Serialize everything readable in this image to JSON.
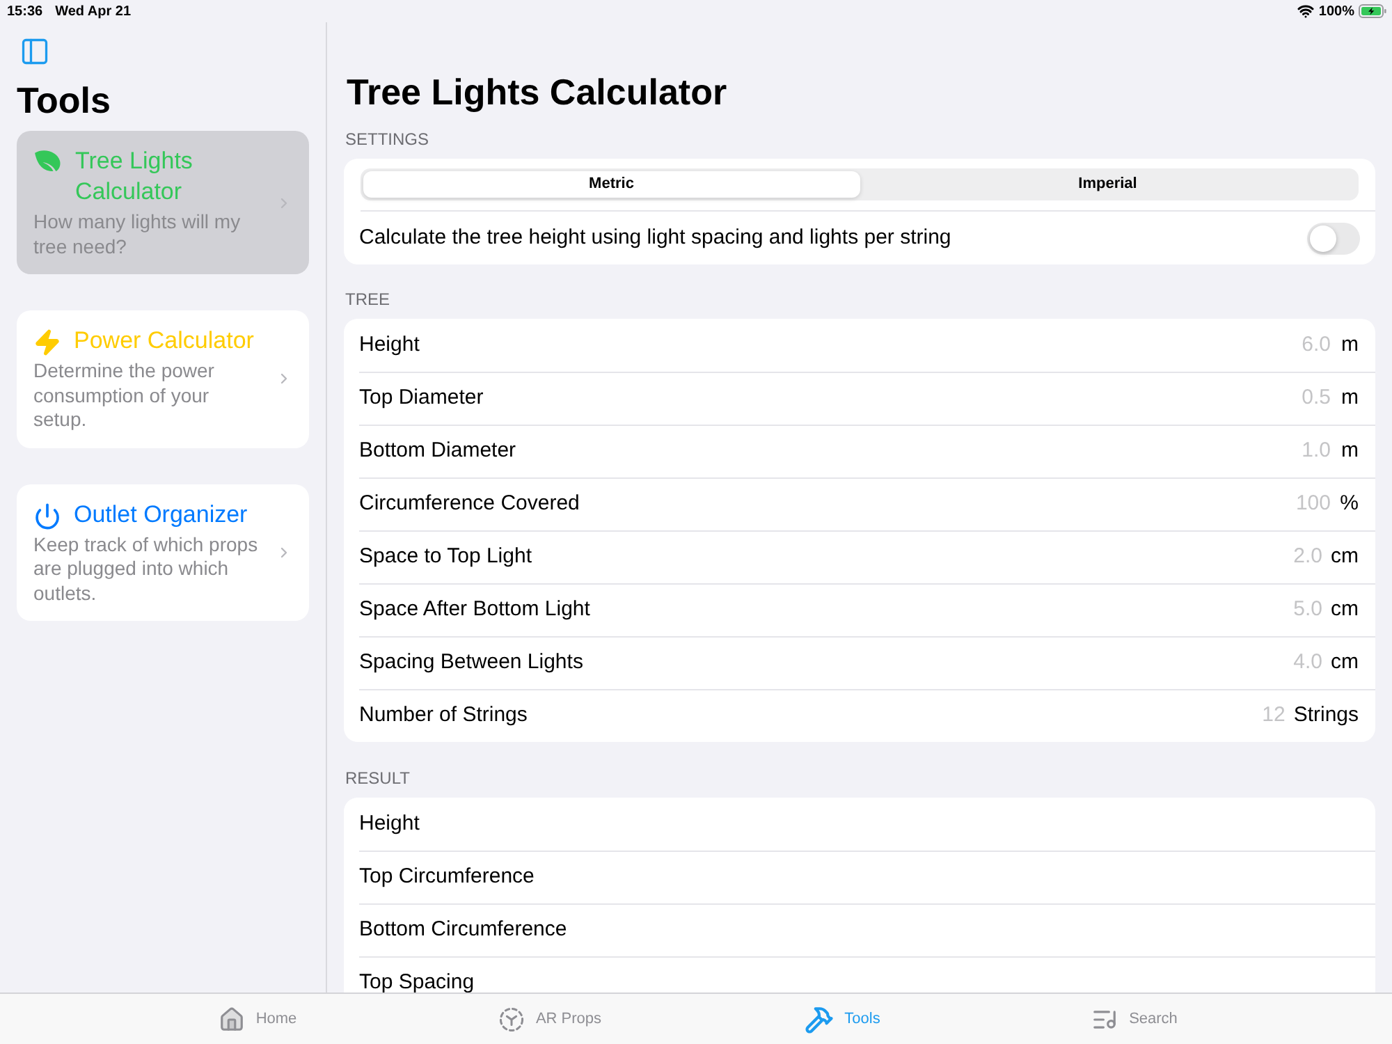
{
  "status_bar": {
    "time": "15:36",
    "date": "Wed Apr 21",
    "battery": "100%"
  },
  "sidebar": {
    "title": "Tools",
    "items": [
      {
        "title": "Tree Lights Calculator",
        "description": "How many lights will my tree need?",
        "color": "#34c759",
        "selected": true
      },
      {
        "title": "Power Calculator",
        "description": "Determine the power consumption of your setup.",
        "color": "#ffcc00",
        "selected": false
      },
      {
        "title": "Outlet Organizer",
        "description": "Keep track of which props are plugged into which outlets.",
        "color": "#007aff",
        "selected": false
      }
    ]
  },
  "main": {
    "title": "Tree Lights Calculator"
  },
  "settings": {
    "header": "SETTINGS",
    "units": [
      {
        "label": "Metric",
        "selected": true
      },
      {
        "label": "Imperial",
        "selected": false
      }
    ],
    "toggle": {
      "label": "Calculate the tree height using light spacing and lights per string",
      "on": false
    }
  },
  "tree": {
    "header": "TREE",
    "fields": [
      {
        "label": "Height",
        "placeholder": "6.0",
        "unit": "m"
      },
      {
        "label": "Top Diameter",
        "placeholder": "0.5",
        "unit": "m"
      },
      {
        "label": "Bottom Diameter",
        "placeholder": "1.0",
        "unit": "m"
      },
      {
        "label": "Circumference Covered",
        "placeholder": "100",
        "unit": "%"
      },
      {
        "label": "Space to Top Light",
        "placeholder": "2.0",
        "unit": "cm"
      },
      {
        "label": "Space After Bottom Light",
        "placeholder": "5.0",
        "unit": "cm"
      },
      {
        "label": "Spacing Between Lights",
        "placeholder": "4.0",
        "unit": "cm"
      },
      {
        "label": "Number of Strings",
        "placeholder": "12",
        "unit": "Strings"
      }
    ]
  },
  "result": {
    "header": "RESULT",
    "rows": [
      {
        "label": "Height"
      },
      {
        "label": "Top Circumference"
      },
      {
        "label": "Bottom Circumference"
      },
      {
        "label": "Top Spacing"
      }
    ]
  },
  "tab_bar": {
    "tabs": [
      {
        "label": "Home",
        "selected": false
      },
      {
        "label": "AR Props",
        "selected": false
      },
      {
        "label": "Tools",
        "selected": true
      },
      {
        "label": "Search",
        "selected": false
      }
    ]
  }
}
